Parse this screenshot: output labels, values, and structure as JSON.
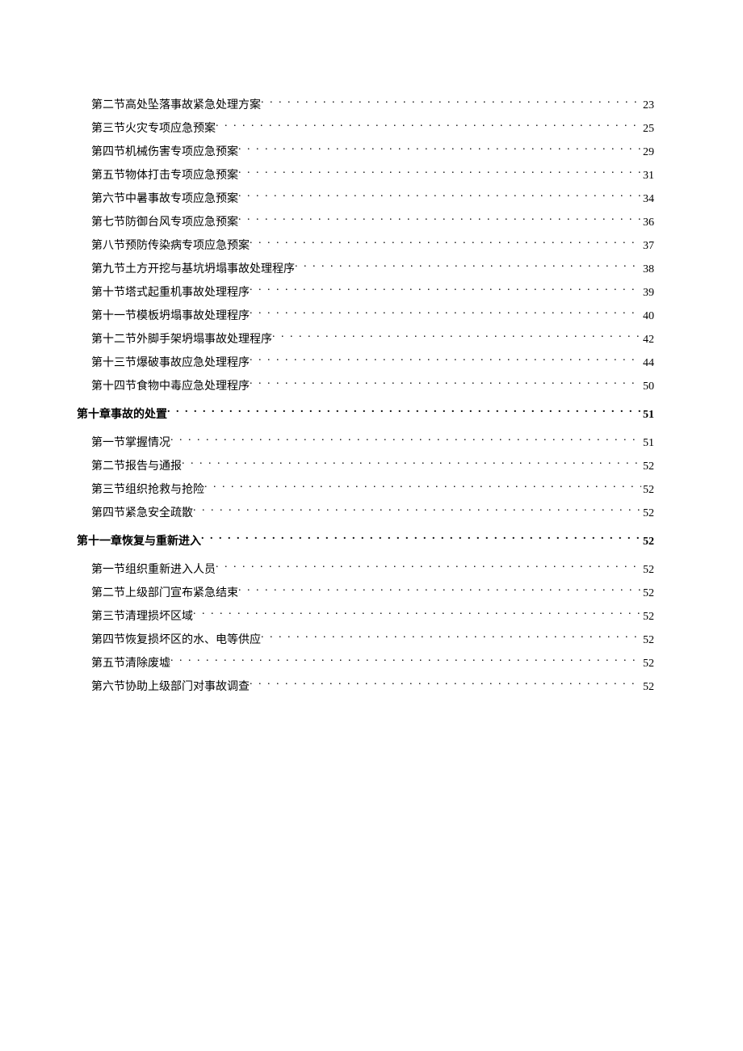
{
  "toc": [
    {
      "type": "section",
      "title": "第二节高处坠落事故紧急处理方案",
      "page": "23"
    },
    {
      "type": "section",
      "title": "第三节火灾专项应急预案",
      "page": "25"
    },
    {
      "type": "section",
      "title": "第四节机械伤害专项应急预案",
      "page": "29"
    },
    {
      "type": "section",
      "title": "第五节物体打击专项应急预案",
      "page": "31"
    },
    {
      "type": "section",
      "title": "第六节中暑事故专项应急预案",
      "page": "34"
    },
    {
      "type": "section",
      "title": "第七节防御台风专项应急预案",
      "page": "36"
    },
    {
      "type": "section",
      "title": "第八节预防传染病专项应急预案",
      "page": "37"
    },
    {
      "type": "section",
      "title": "第九节土方开挖与基坑坍塌事故处理程序",
      "page": "38"
    },
    {
      "type": "section",
      "title": "第十节塔式起重机事故处理程序",
      "page": "39"
    },
    {
      "type": "section",
      "title": "第十一节模板坍塌事故处理程序",
      "page": "40"
    },
    {
      "type": "section",
      "title": "第十二节外脚手架坍塌事故处理程序",
      "page": "42"
    },
    {
      "type": "section",
      "title": "第十三节爆破事故应急处理程序",
      "page": "44"
    },
    {
      "type": "section",
      "title": "第十四节食物中毒应急处理程序",
      "page": "50"
    },
    {
      "type": "chapter",
      "title": "第十章事故的处置",
      "page": "51"
    },
    {
      "type": "section",
      "title": "第一节掌握情况",
      "page": "51"
    },
    {
      "type": "section",
      "title": "第二节报告与通报",
      "page": "52"
    },
    {
      "type": "section",
      "title": "第三节组织抢救与抢险",
      "page": "52"
    },
    {
      "type": "section",
      "title": "第四节紧急安全疏散",
      "page": "52"
    },
    {
      "type": "chapter",
      "title": "第十一章恢复与重新进入",
      "page": "52"
    },
    {
      "type": "section",
      "title": "第一节组织重新进入人员",
      "page": "52"
    },
    {
      "type": "section",
      "title": "第二节上级部门宣布紧急结束",
      "page": "52"
    },
    {
      "type": "section",
      "title": "第三节清理损坏区域",
      "page": "52"
    },
    {
      "type": "section",
      "title": "第四节恢复损坏区的水、电等供应",
      "page": "52"
    },
    {
      "type": "section",
      "title": "第五节清除废墟",
      "page": "52"
    },
    {
      "type": "section",
      "title": "第六节协助上级部门对事故调查",
      "page": "52"
    }
  ]
}
